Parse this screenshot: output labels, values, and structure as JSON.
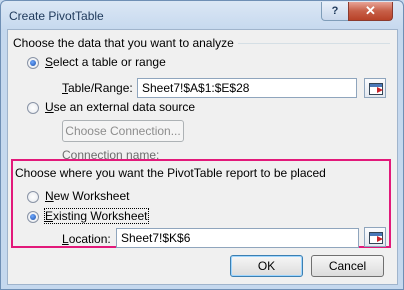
{
  "window": {
    "title": "Create PivotTable",
    "help_label": "?",
    "close_label": "✕"
  },
  "section1": {
    "heading": "Choose the data that you want to analyze",
    "select_table": {
      "label": "Select a table or range",
      "selected": true
    },
    "table_range": {
      "label": "Table/Range:",
      "value": "Sheet7!$A$1:$E$28"
    },
    "external": {
      "label": "Use an external data source",
      "selected": false
    },
    "choose_connection": {
      "label": "Choose Connection..."
    },
    "connection_name": {
      "label": "Connection name:"
    }
  },
  "section2": {
    "heading": "Choose where you want the PivotTable report to be placed",
    "new_worksheet": {
      "label": "New Worksheet",
      "selected": false
    },
    "existing_worksheet": {
      "label": "Existing Worksheet",
      "selected": true
    },
    "location": {
      "label": "Location:",
      "value": "Sheet7!$K$6"
    }
  },
  "footer": {
    "ok_label": "OK",
    "cancel_label": "Cancel"
  },
  "colors": {
    "highlight": "#e2197a",
    "title_text": "#1e395b",
    "close_button": "#c75f48"
  },
  "icons": [
    "help-icon",
    "close-icon",
    "range-selector-icon"
  ]
}
